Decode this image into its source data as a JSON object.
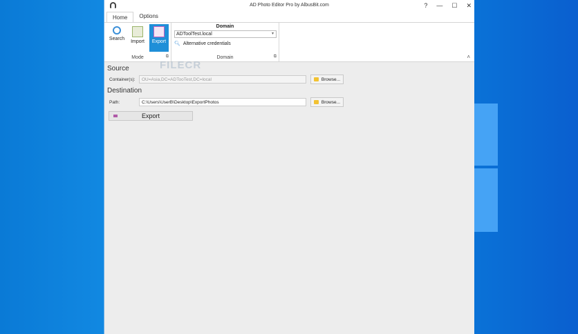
{
  "window": {
    "title": "AD Photo Editor Pro by AlbusBit.com",
    "help": "?",
    "minimize": "—",
    "maximize": "☐",
    "close": "✕"
  },
  "tabs": [
    {
      "label": "Home"
    },
    {
      "label": "Options"
    }
  ],
  "ribbon": {
    "mode": {
      "label": "Mode",
      "buttons": [
        {
          "label": "Search",
          "icon": "search-icon"
        },
        {
          "label": "Import",
          "icon": "import-icon"
        },
        {
          "label": "Export",
          "icon": "export-icon"
        }
      ]
    },
    "domain": {
      "title": "Domain",
      "label": "Domain",
      "selected": "ADToolTest.local",
      "alt_credentials": "Alternative credentials"
    },
    "collapse": "˄"
  },
  "source": {
    "heading": "Source",
    "container_label": "Container(s):",
    "container_value": "OU=Asia,DC=ADTooTest,DC=local",
    "browse": "Browse..."
  },
  "destination": {
    "heading": "Destination",
    "path_label": "Path:",
    "path_value": "C:\\Users\\UserB\\Desktop\\ExportPhotos",
    "browse": "Browse..."
  },
  "export_button": "Export",
  "watermark": "FILECR"
}
